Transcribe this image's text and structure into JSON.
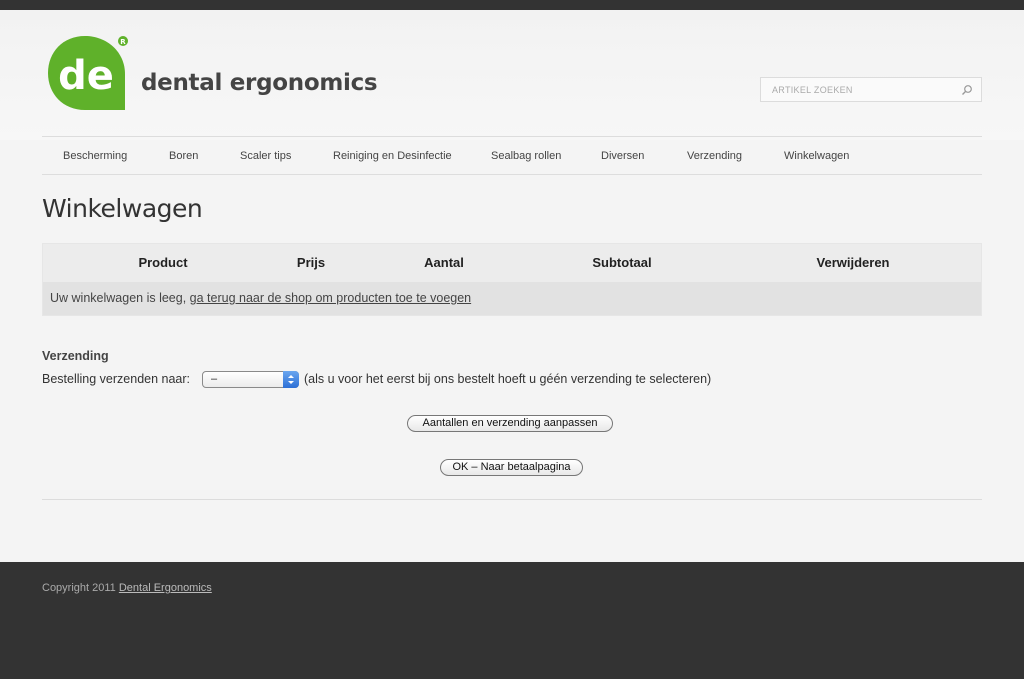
{
  "brand": {
    "logo_text": "de",
    "registered": "R",
    "name": "dental ergonomics",
    "accent_color": "#5fb12a"
  },
  "search": {
    "placeholder": "ARTIKEL ZOEKEN",
    "icon": "search-icon"
  },
  "nav": [
    {
      "label": "Bescherming"
    },
    {
      "label": "Boren"
    },
    {
      "label": "Scaler tips"
    },
    {
      "label": "Reiniging en Desinfectie"
    },
    {
      "label": "Sealbag rollen"
    },
    {
      "label": "Diversen"
    },
    {
      "label": "Verzending"
    },
    {
      "label": "Winkelwagen"
    }
  ],
  "page": {
    "title": "Winkelwagen"
  },
  "cart": {
    "columns": [
      "Product",
      "Prijs",
      "Aantal",
      "Subtotaal",
      "Verwijderen"
    ],
    "empty_text": "Uw winkelwagen is leeg,",
    "empty_link": "ga terug naar de shop om producten toe te voegen"
  },
  "shipping": {
    "heading": "Verzending",
    "label": "Bestelling verzenden naar:",
    "selected": "–",
    "note": "(als u voor het eerst bij ons bestelt hoeft u géén verzending te selecteren)"
  },
  "buttons": {
    "update": "Aantallen en verzending aanpassen",
    "checkout": "OK – Naar betaalpagina"
  },
  "footer": {
    "copyright": "Copyright 2011",
    "link": "Dental Ergonomics"
  }
}
